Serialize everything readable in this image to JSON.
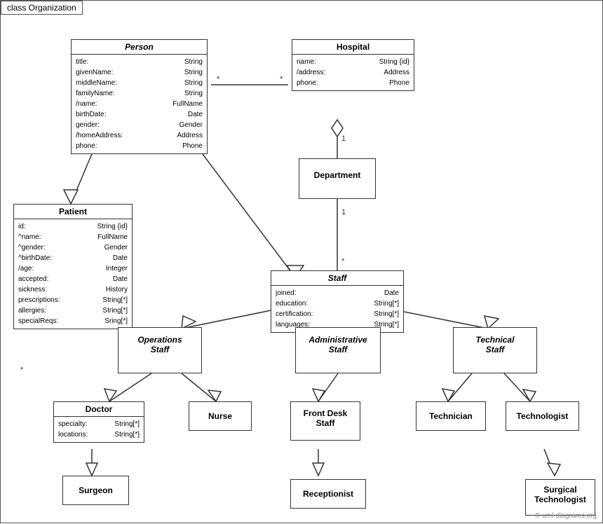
{
  "title": "class Organization",
  "copyright": "© uml-diagrams.org",
  "classes": {
    "person": {
      "name": "Person",
      "italic": true,
      "attrs": [
        {
          "name": "title:",
          "type": "String"
        },
        {
          "name": "givenName:",
          "type": "String"
        },
        {
          "name": "middleName:",
          "type": "String"
        },
        {
          "name": "familyName:",
          "type": "String"
        },
        {
          "name": "/name:",
          "type": "FullName"
        },
        {
          "name": "birthDate:",
          "type": "Date"
        },
        {
          "name": "gender:",
          "type": "Gender"
        },
        {
          "name": "/homeAddress:",
          "type": "Address"
        },
        {
          "name": "phone:",
          "type": "Phone"
        }
      ]
    },
    "hospital": {
      "name": "Hospital",
      "italic": false,
      "attrs": [
        {
          "name": "name:",
          "type": "String {id}"
        },
        {
          "name": "/address:",
          "type": "Address"
        },
        {
          "name": "phone:",
          "type": "Phone"
        }
      ]
    },
    "patient": {
      "name": "Patient",
      "italic": false,
      "attrs": [
        {
          "name": "id:",
          "type": "String {id}"
        },
        {
          "name": "^name:",
          "type": "FullName"
        },
        {
          "name": "^gender:",
          "type": "Gender"
        },
        {
          "name": "^birthDate:",
          "type": "Date"
        },
        {
          "name": "/age:",
          "type": "Integer"
        },
        {
          "name": "accepted:",
          "type": "Date"
        },
        {
          "name": "sickness:",
          "type": "History"
        },
        {
          "name": "prescriptions:",
          "type": "String[*]"
        },
        {
          "name": "allergies:",
          "type": "String[*]"
        },
        {
          "name": "specialReqs:",
          "type": "Sring[*]"
        }
      ]
    },
    "department": {
      "name": "Department",
      "italic": false,
      "attrs": []
    },
    "staff": {
      "name": "Staff",
      "italic": true,
      "attrs": [
        {
          "name": "joined:",
          "type": "Date"
        },
        {
          "name": "education:",
          "type": "String[*]"
        },
        {
          "name": "certification:",
          "type": "String[*]"
        },
        {
          "name": "languages:",
          "type": "String[*]"
        }
      ]
    },
    "operations_staff": {
      "name": "Operations Staff",
      "italic": true,
      "attrs": []
    },
    "administrative_staff": {
      "name": "Administrative Staff",
      "italic": true,
      "attrs": []
    },
    "technical_staff": {
      "name": "Technical Staff",
      "italic": true,
      "attrs": []
    },
    "doctor": {
      "name": "Doctor",
      "italic": false,
      "attrs": [
        {
          "name": "specialty:",
          "type": "String[*]"
        },
        {
          "name": "locations:",
          "type": "String[*]"
        }
      ]
    },
    "nurse": {
      "name": "Nurse",
      "italic": false,
      "attrs": []
    },
    "front_desk_staff": {
      "name": "Front Desk Staff",
      "italic": false,
      "attrs": []
    },
    "technician": {
      "name": "Technician",
      "italic": false,
      "attrs": []
    },
    "technologist": {
      "name": "Technologist",
      "italic": false,
      "attrs": []
    },
    "surgeon": {
      "name": "Surgeon",
      "italic": false,
      "attrs": []
    },
    "receptionist": {
      "name": "Receptionist",
      "italic": false,
      "attrs": []
    },
    "surgical_technologist": {
      "name": "Surgical Technologist",
      "italic": false,
      "attrs": []
    }
  },
  "multiplicity": {
    "star": "*",
    "one": "1"
  }
}
